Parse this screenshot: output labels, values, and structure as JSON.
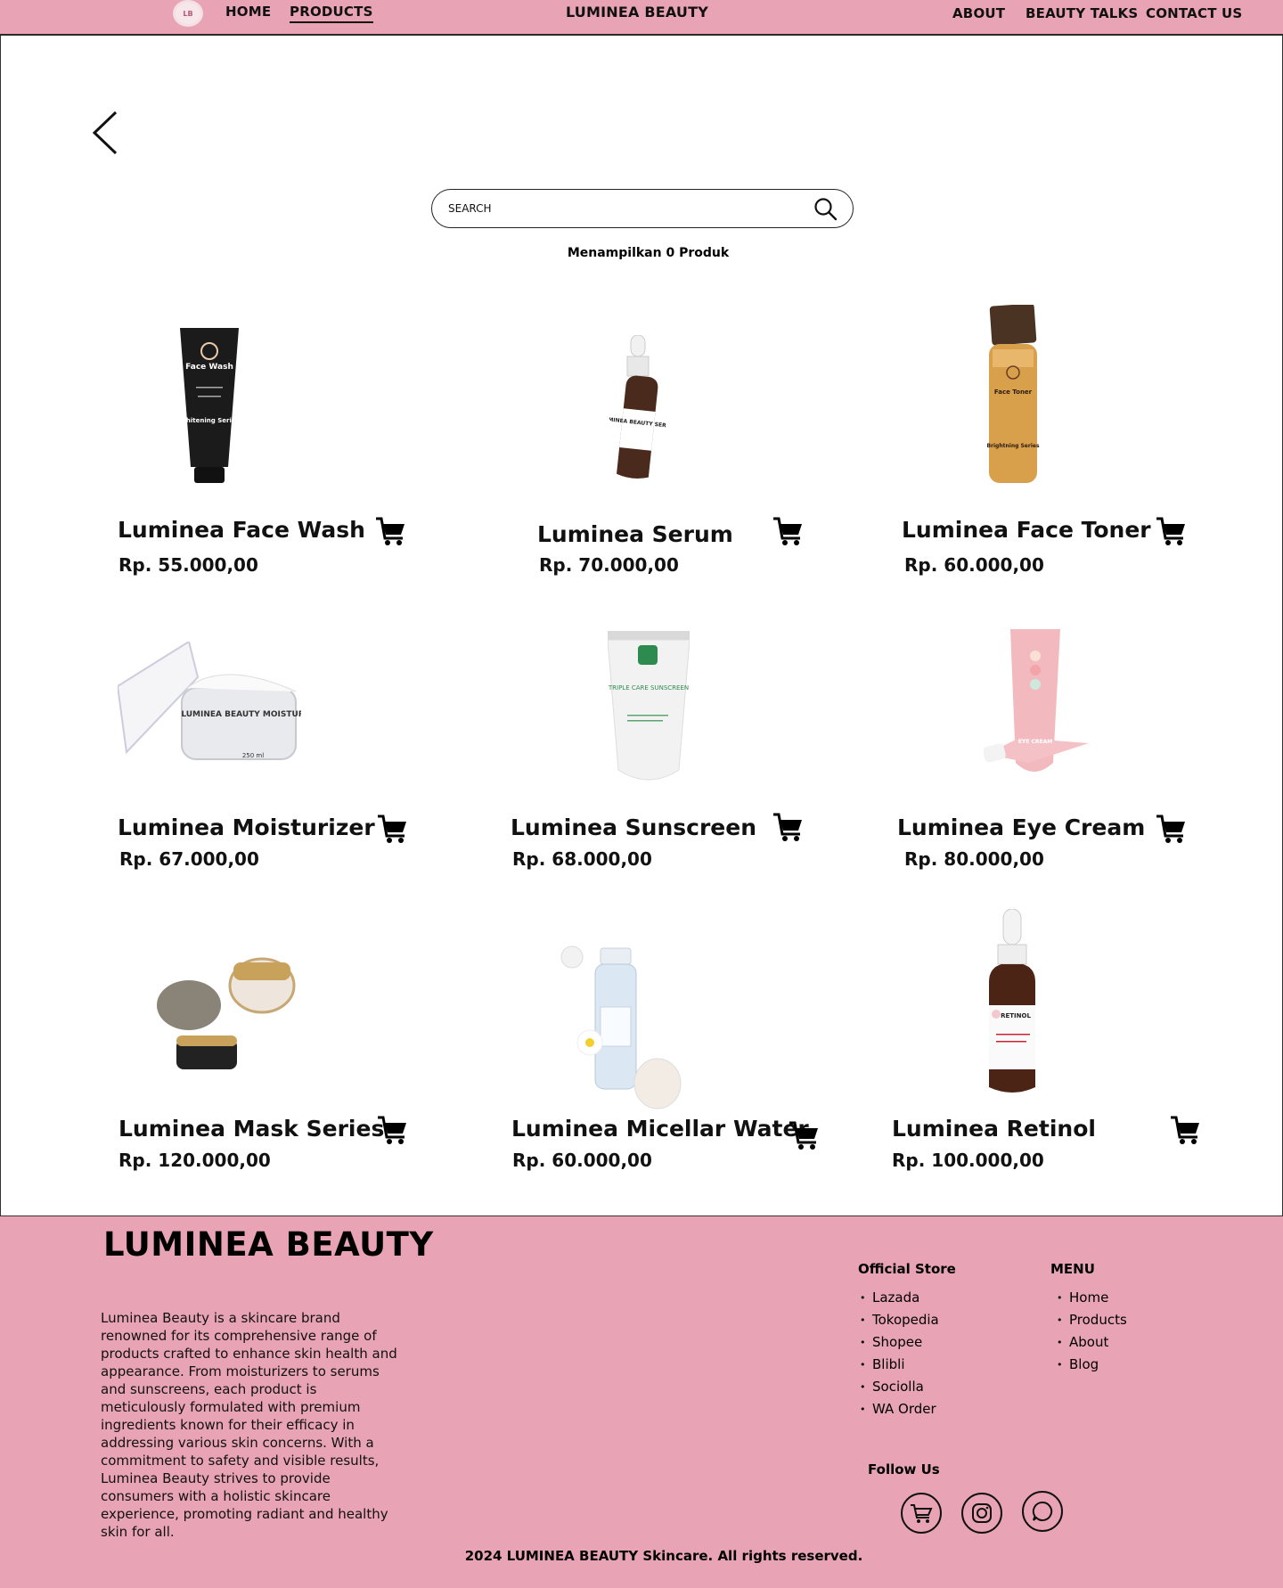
{
  "nav": {
    "logo_text": "LB",
    "home": "HOME",
    "products": "PRODUCTS",
    "brand": "LUMINEA BEAUTY",
    "about": "ABOUT",
    "beauty_talks": "BEAUTY TALKS",
    "contact": "CONTACT US"
  },
  "search": {
    "placeholder": "SEARCH",
    "result_count": "Menampilkan 0 Produk"
  },
  "products": [
    {
      "name": "Luminea Face Wash",
      "price": "Rp. 55.000,00",
      "icon": "face-wash-tube",
      "label": "Face Wash",
      "sub": "Whitening Series"
    },
    {
      "name": "Luminea Serum",
      "price": "Rp. 70.000,00",
      "icon": "serum-dropper-bottle",
      "label": "LUMINEA BEAUTY SERUM"
    },
    {
      "name": "Luminea Face Toner",
      "price": "Rp. 60.000,00",
      "icon": "toner-bottle",
      "label": "Face Toner",
      "sub": "Brightning Series"
    },
    {
      "name": "Luminea Moisturizer",
      "price": "Rp. 67.000,00",
      "icon": "moisturizer-jar",
      "label": "LUMINEA BEAUTY MOISTURIZER",
      "sub": "250 ml"
    },
    {
      "name": "Luminea Sunscreen",
      "price": "Rp. 68.000,00",
      "icon": "sunscreen-tube",
      "label": "TRIPLE CARE SUNSCREEN"
    },
    {
      "name": "Luminea Eye Cream",
      "price": "Rp. 80.000,00",
      "icon": "eye-cream-tube",
      "label": "EYE CREAM"
    },
    {
      "name": "Luminea Mask Series",
      "price": "Rp. 120.000,00",
      "icon": "mask-jars"
    },
    {
      "name": "Luminea Micellar Water",
      "price": "Rp. 60.000,00",
      "icon": "micellar-bottle"
    },
    {
      "name": "Luminea Retinol",
      "price": "Rp. 100.000,00",
      "icon": "retinol-dropper-bottle",
      "label": "RETINOL"
    }
  ],
  "footer": {
    "title": "LUMINEA BEAUTY",
    "description": "Luminea Beauty is a skincare brand renowned for its comprehensive range of products crafted to enhance skin health and appearance. From moisturizers to serums and sunscreens, each product is meticulously formulated with premium ingredients known for their efficacy in addressing various skin concerns. With a commitment to safety and visible results, Luminea Beauty strives to provide consumers with a holistic skincare experience, promoting radiant and healthy skin for all.",
    "official_store_title": "Official Store",
    "official_store": [
      "Lazada",
      "Tokopedia",
      "Shopee",
      "Blibli",
      "Sociolla",
      "WA Order"
    ],
    "menu_title": "MENU",
    "menu": [
      "Home",
      "Products",
      "About",
      "Blog"
    ],
    "follow_us": "Follow Us",
    "social": [
      "shopping-cart-icon",
      "instagram-icon",
      "whatsapp-icon"
    ],
    "copyright": "2024 LUMINEA BEAUTY Skincare. All rights reserved."
  },
  "colors": {
    "accent_pink": "#e8a3b4",
    "text": "#111111",
    "background": "#ffffff"
  }
}
